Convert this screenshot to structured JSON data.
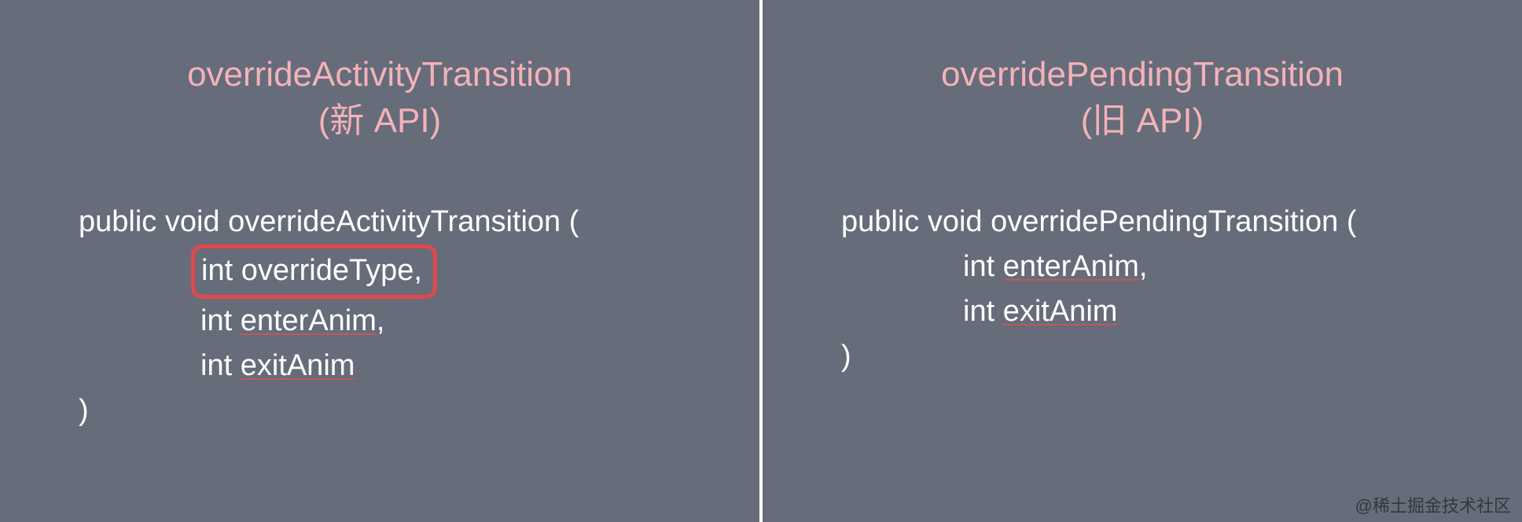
{
  "left": {
    "title_line1": "overrideActivityTransition",
    "title_line2": "(新 API)",
    "sig_open": "public void overrideActivityTransition (",
    "param1": "int overrideType,",
    "param2_prefix": "int ",
    "param2_underlined": "enterAnim",
    "param2_suffix": ",",
    "param3_prefix": "int ",
    "param3_underlined": "exitAnim",
    "sig_close": ")"
  },
  "right": {
    "title_line1": "overridePendingTransition",
    "title_line2": "(旧 API)",
    "sig_open": "public void overridePendingTransition (",
    "param1_prefix": "int ",
    "param1_underlined": "enterAnim",
    "param1_suffix": ",",
    "param2_prefix": "int ",
    "param2_underlined": "exitAnim",
    "sig_close": ")"
  },
  "watermark": "@稀土掘金技术社区"
}
